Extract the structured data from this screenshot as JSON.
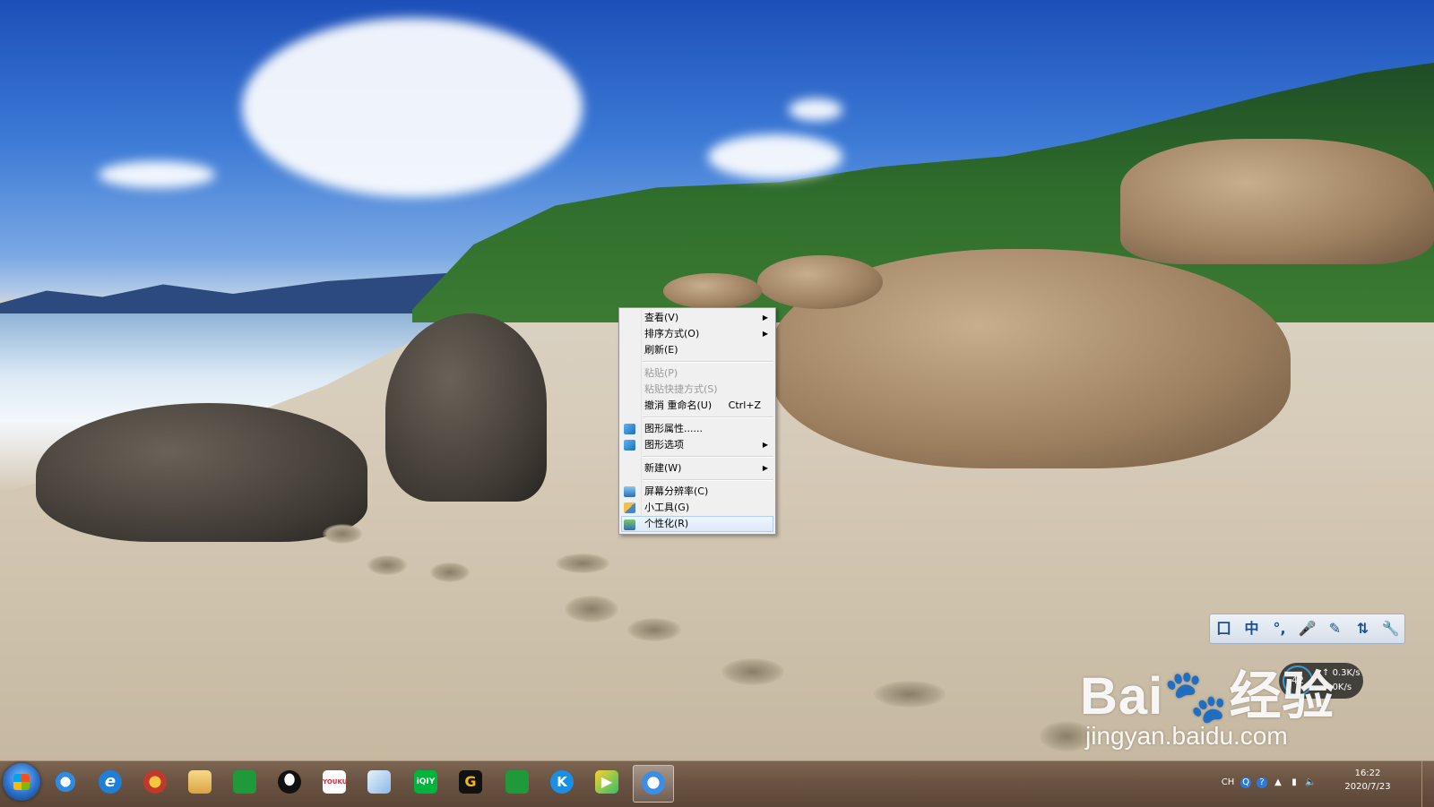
{
  "context_menu": {
    "items": [
      {
        "label": "查看(V)",
        "submenu": true
      },
      {
        "label": "排序方式(O)",
        "submenu": true
      },
      {
        "label": "刷新(E)"
      },
      {
        "label": "粘贴(P)",
        "disabled": true
      },
      {
        "label": "粘贴快捷方式(S)",
        "disabled": true
      },
      {
        "label": "撤消 重命名(U)",
        "shortcut": "Ctrl+Z"
      },
      {
        "label": "图形属性......",
        "icon": "graphics-properties-icon"
      },
      {
        "label": "图形选项",
        "icon": "graphics-options-icon",
        "submenu": true
      },
      {
        "label": "新建(W)",
        "submenu": true
      },
      {
        "label": "屏幕分辨率(C)",
        "icon": "screen-resolution-icon"
      },
      {
        "label": "小工具(G)",
        "icon": "gadgets-icon"
      },
      {
        "label": "个性化(R)",
        "icon": "personalize-icon",
        "highlighted": true
      }
    ]
  },
  "ime_toolbar": {
    "buttons": [
      "囗",
      "中",
      "°,",
      "🎤",
      "✎",
      "⇅",
      "🔧"
    ]
  },
  "net_widget": {
    "percent": "42",
    "upload": "0.3K/s",
    "download": "0K/s"
  },
  "watermark": {
    "brand": "Bai🐾经验",
    "url": "jingyan.baidu.com"
  },
  "taskbar": {
    "apps": [
      "baidu-netdisk-icon",
      "internet-explorer-icon",
      "game-icon",
      "file-explorer-icon",
      "green-app-icon",
      "qq-penguin-icon",
      "youku-icon",
      "paper-plane-icon",
      "iqiyi-icon",
      "g-app-icon",
      "green-app-2-icon",
      "kugou-icon",
      "video-player-icon",
      "active-app-icon"
    ],
    "app_labels": [
      "",
      "e",
      "",
      "",
      "",
      "",
      "YOUKU",
      "",
      "iQIY",
      "G",
      "",
      "K",
      "▶",
      ""
    ],
    "tray": {
      "lang": "CH",
      "clock_time": "16:22",
      "clock_date": "2020/7/23"
    }
  }
}
